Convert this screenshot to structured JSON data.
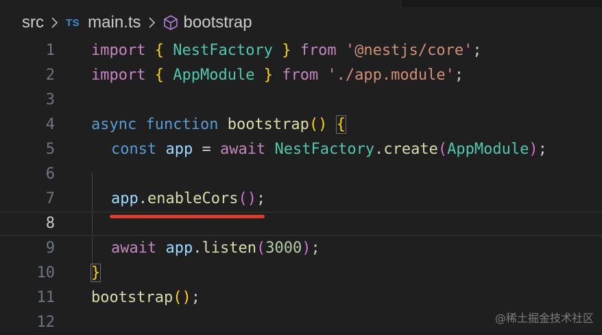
{
  "breadcrumb": {
    "folder": "src",
    "file": "main.ts",
    "file_badge": "TS",
    "symbol": "bootstrap"
  },
  "editor": {
    "current_line": 8,
    "lines": [
      {
        "n": "1",
        "tokens": [
          [
            "kw",
            "import"
          ],
          [
            "plain",
            " "
          ],
          [
            "p1",
            "{"
          ],
          [
            "plain",
            " "
          ],
          [
            "type",
            "NestFactory"
          ],
          [
            "plain",
            " "
          ],
          [
            "p1",
            "}"
          ],
          [
            "plain",
            " "
          ],
          [
            "kw",
            "from"
          ],
          [
            "plain",
            " "
          ],
          [
            "str",
            "'@nestjs/core'"
          ],
          [
            "plain",
            ";"
          ]
        ]
      },
      {
        "n": "2",
        "tokens": [
          [
            "kw",
            "import"
          ],
          [
            "plain",
            " "
          ],
          [
            "p1",
            "{"
          ],
          [
            "plain",
            " "
          ],
          [
            "type",
            "AppModule"
          ],
          [
            "plain",
            " "
          ],
          [
            "p1",
            "}"
          ],
          [
            "plain",
            " "
          ],
          [
            "kw",
            "from"
          ],
          [
            "plain",
            " "
          ],
          [
            "str",
            "'./app.module'"
          ],
          [
            "plain",
            ";"
          ]
        ]
      },
      {
        "n": "3",
        "tokens": []
      },
      {
        "n": "4",
        "tokens": [
          [
            "kw2",
            "async"
          ],
          [
            "plain",
            " "
          ],
          [
            "kw2",
            "function"
          ],
          [
            "plain",
            " "
          ],
          [
            "fn",
            "bootstrap"
          ],
          [
            "p1",
            "()"
          ],
          [
            "plain",
            " "
          ],
          [
            "p1box",
            "{"
          ]
        ]
      },
      {
        "n": "5",
        "tokens": [
          [
            "kw2",
            "const"
          ],
          [
            "plain",
            " "
          ],
          [
            "var",
            "app"
          ],
          [
            "plain",
            " = "
          ],
          [
            "kw",
            "await"
          ],
          [
            "plain",
            " "
          ],
          [
            "type",
            "NestFactory"
          ],
          [
            "plain",
            "."
          ],
          [
            "fn",
            "create"
          ],
          [
            "p2",
            "("
          ],
          [
            "type",
            "AppModule"
          ],
          [
            "p2",
            ")"
          ],
          [
            "plain",
            ";"
          ]
        ]
      },
      {
        "n": "6",
        "tokens": []
      },
      {
        "n": "7",
        "tokens": [
          [
            "var",
            "app"
          ],
          [
            "plain",
            "."
          ],
          [
            "fn",
            "enableCors"
          ],
          [
            "p2",
            "()"
          ],
          [
            "plain",
            ";"
          ]
        ]
      },
      {
        "n": "8",
        "tokens": []
      },
      {
        "n": "9",
        "tokens": [
          [
            "kw",
            "await"
          ],
          [
            "plain",
            " "
          ],
          [
            "var",
            "app"
          ],
          [
            "plain",
            "."
          ],
          [
            "fn",
            "listen"
          ],
          [
            "p2",
            "("
          ],
          [
            "num",
            "3000"
          ],
          [
            "p2",
            ")"
          ],
          [
            "plain",
            ";"
          ]
        ]
      },
      {
        "n": "10",
        "tokens": [
          [
            "p1box",
            "}"
          ]
        ]
      },
      {
        "n": "11",
        "tokens": [
          [
            "fn",
            "bootstrap"
          ],
          [
            "p1",
            "()"
          ],
          [
            "plain",
            ";"
          ]
        ]
      },
      {
        "n": "12",
        "tokens": []
      }
    ]
  },
  "annotation": {
    "color": "#e03a2f"
  },
  "watermark": "@稀土掘金技术社区",
  "colors": {
    "background": "#1f1f1f",
    "keyword_control": "#c586c0",
    "keyword_storage": "#569cd6",
    "type": "#4ec9b0",
    "variable": "#9cdcfe",
    "function": "#dcdcaa",
    "string": "#ce9178",
    "number": "#b5cea8",
    "bracket_level1": "#ffd700",
    "bracket_level2": "#da70d6"
  },
  "icons": {
    "breadcrumb_separator": "chevron-right-icon",
    "symbol": "cube-icon"
  }
}
